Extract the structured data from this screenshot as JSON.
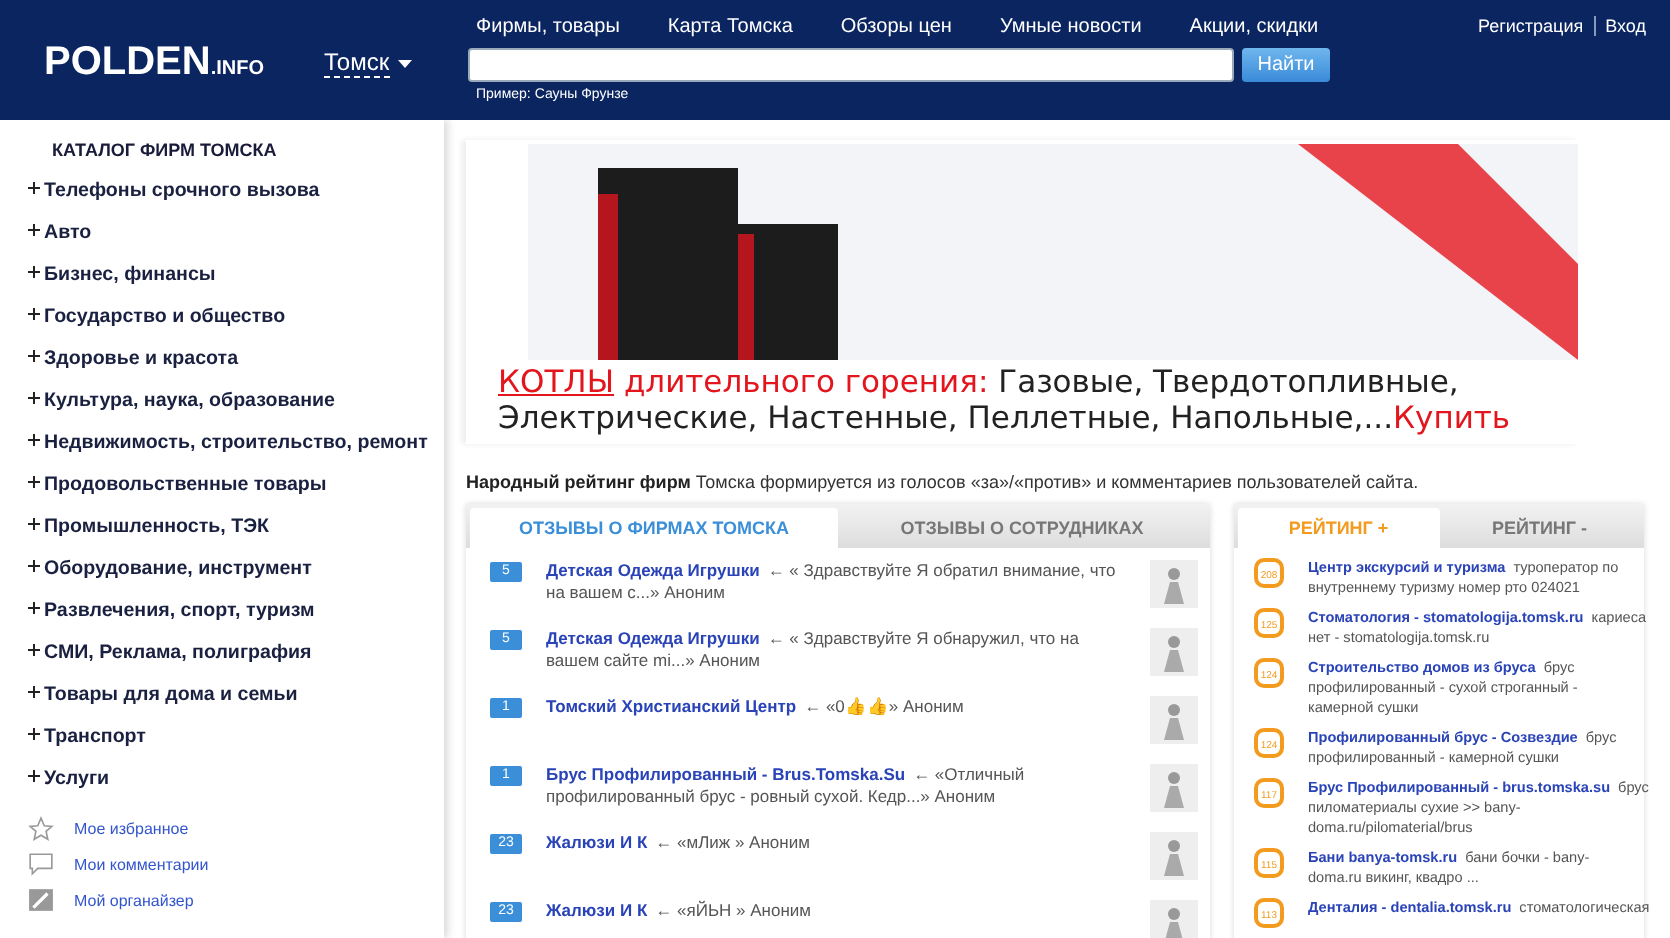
{
  "header": {
    "logo": "POLDEN",
    "logo_suffix": ".INFO",
    "city": "Томск",
    "nav": [
      "Фирмы, товары",
      "Карта Томска",
      "Обзоры цен",
      "Умные новости",
      "Акции, скидки"
    ],
    "search": {
      "button": "Найти",
      "hint": "Пример: Сауны Фрунзе"
    },
    "account": [
      "Регистрация",
      "Вход"
    ]
  },
  "sidebar": {
    "title": "КАТАЛОГ ФИРМ ТОМСКА",
    "items": [
      {
        "label": "Телефоны срочного вызова"
      },
      {
        "label": "Авто"
      },
      {
        "label": "Бизнес, финансы"
      },
      {
        "label": "Государство и общество"
      },
      {
        "label": "Здоровье и красота"
      },
      {
        "label": "Культура, наука, образование"
      },
      {
        "label": "Недвижимость, строительство, ремонт"
      },
      {
        "label": "Продовольственные товары"
      },
      {
        "label": "Промышленность, ТЭК"
      },
      {
        "label": "Оборудование, инструмент"
      },
      {
        "label": "Развлечения, спорт, туризм"
      },
      {
        "label": "СМИ, Реклама, полиграфия"
      },
      {
        "label": "Товары для дома и семьи"
      },
      {
        "label": "Транспорт"
      },
      {
        "label": "Услуги"
      }
    ],
    "links": [
      {
        "kind": "favorites",
        "label": "Мое избранное"
      },
      {
        "kind": "comments",
        "label": "Мои комментарии"
      },
      {
        "kind": "organizer",
        "label": "Мой органайзер"
      }
    ]
  },
  "ad": {
    "link": "КОТЛЫ",
    "highlight": " длительного горения:",
    "text": " Газовые, Твердотопливные, Электрические, Настенные, Пеллетные, Напольные,...",
    "buy": "Купить"
  },
  "rating_intro": "**Народный рейтинг фирм** Томска формируется из голосов «за»/«против» и комментариев пользователей сайта.",
  "reviews": {
    "tabs": [
      {
        "label": "ОТЗЫВЫ О ФИРМАХ ТОМСКА",
        "selected": true
      },
      {
        "label": "ОТЗЫВЫ О СОТРУДНИКАХ",
        "selected": false
      }
    ],
    "rows": [
      {
        "count": "5",
        "firm": "Детская Одежда Игрушки",
        "text": "← « Здравствуйте Я обратил внимание, что на вашем с...» Аноним"
      },
      {
        "count": "5",
        "firm": "Детская Одежда Игрушки",
        "text": "← « Здравствуйте Я обнаружил, что на вашем сайте mi...» Аноним"
      },
      {
        "count": "1",
        "firm": "Томский Христианский Центр",
        "text": "← «0👍👍» Аноним"
      },
      {
        "count": "1",
        "firm": "Брус Профилированный - Brus.Tomska.Su",
        "text": "← «Отличный профилированный брус - ровный сухой. Кедр...» Аноним"
      },
      {
        "count": "23",
        "firm": "Жалюзи И К",
        "text": "← «мЛиж » Аноним"
      },
      {
        "count": "23",
        "firm": "Жалюзи И К",
        "text": "← «яЙЬН » Аноним"
      }
    ]
  },
  "ratings": {
    "tabs": [
      {
        "label": "РЕЙТИНГ +",
        "selected": true
      },
      {
        "label": "РЕЙТИНГ -",
        "selected": false
      }
    ],
    "rows": [
      {
        "score": "208",
        "firm": "Центр экскурсий и туризма",
        "text": "туроператор по внутреннему туризму номер рто 024021"
      },
      {
        "score": "125",
        "firm": "Стоматология - stomatologija.tomsk.ru",
        "text": "кариеса нет - stomatologija.tomsk.ru"
      },
      {
        "score": "124",
        "firm": "Строительство домов из бруса",
        "text": "брус профилированный - сухой строганный - камерной сушки"
      },
      {
        "score": "124",
        "firm": "Профилированный брус - Созвездие",
        "text": "брус профилированный - камерной сушки"
      },
      {
        "score": "117",
        "firm": "Брус Профилированный - brus.tomska.su",
        "text": "брус пиломатериалы сухие >> bany-doma.ru/pilomaterial/brus"
      },
      {
        "score": "115",
        "firm": "Бани banya-tomsk.ru",
        "text": "бани бочки - bany-doma.ru викинг, квадро ..."
      },
      {
        "score": "113",
        "firm": "Денталия - dentalia.tomsk.ru",
        "text": "стоматологическая"
      }
    ]
  }
}
